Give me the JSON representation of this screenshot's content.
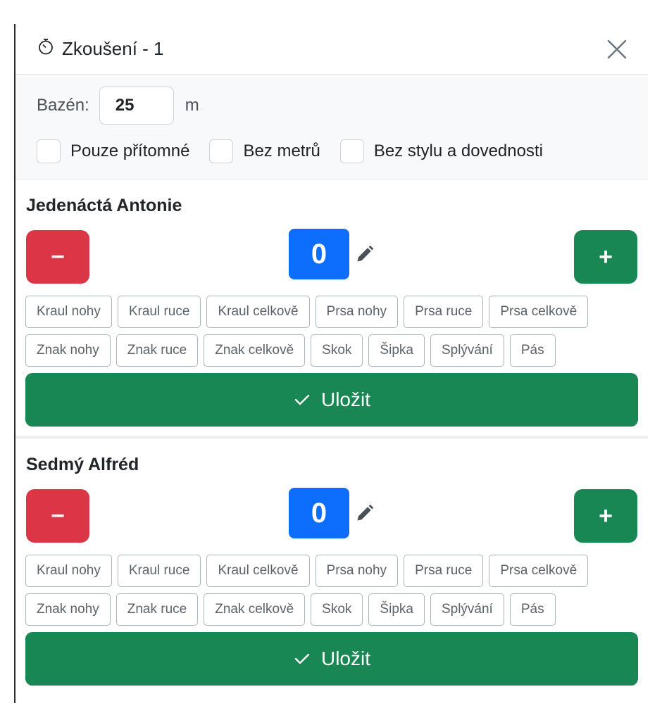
{
  "header": {
    "title": "Zkoušení - 1",
    "icon": "stopwatch-icon",
    "close_icon": "close-icon"
  },
  "settings": {
    "pool_label": "Bazén:",
    "pool_value": "25",
    "pool_unit": "m",
    "checkboxes": [
      {
        "label": "Pouze přítomné",
        "checked": false
      },
      {
        "label": "Bez metrů",
        "checked": false
      },
      {
        "label": "Bez stylu a dovednosti",
        "checked": false
      }
    ]
  },
  "students": [
    {
      "name": "Jedenáctá Antonie",
      "count": "0",
      "minus_label": "−",
      "plus_label": "+",
      "skills_row1": [
        "Kraul nohy",
        "Kraul ruce",
        "Kraul celkově",
        "Prsa nohy",
        "Prsa ruce",
        "Prsa celkově"
      ],
      "skills_row2": [
        "Znak nohy",
        "Znak ruce",
        "Znak celkově",
        "Skok",
        "Šipka",
        "Splývání",
        "Pás"
      ],
      "save_label": "Uložit"
    },
    {
      "name": "Sedmý Alfréd",
      "count": "0",
      "minus_label": "−",
      "plus_label": "+",
      "skills_row1": [
        "Kraul nohy",
        "Kraul ruce",
        "Kraul celkově",
        "Prsa nohy",
        "Prsa ruce",
        "Prsa celkově"
      ],
      "skills_row2": [
        "Znak nohy",
        "Znak ruce",
        "Znak celkově",
        "Skok",
        "Šipka",
        "Splývání",
        "Pás"
      ],
      "save_label": "Uložit"
    }
  ],
  "colors": {
    "danger": "#dc3545",
    "success": "#198754",
    "primary": "#0d6efd"
  }
}
